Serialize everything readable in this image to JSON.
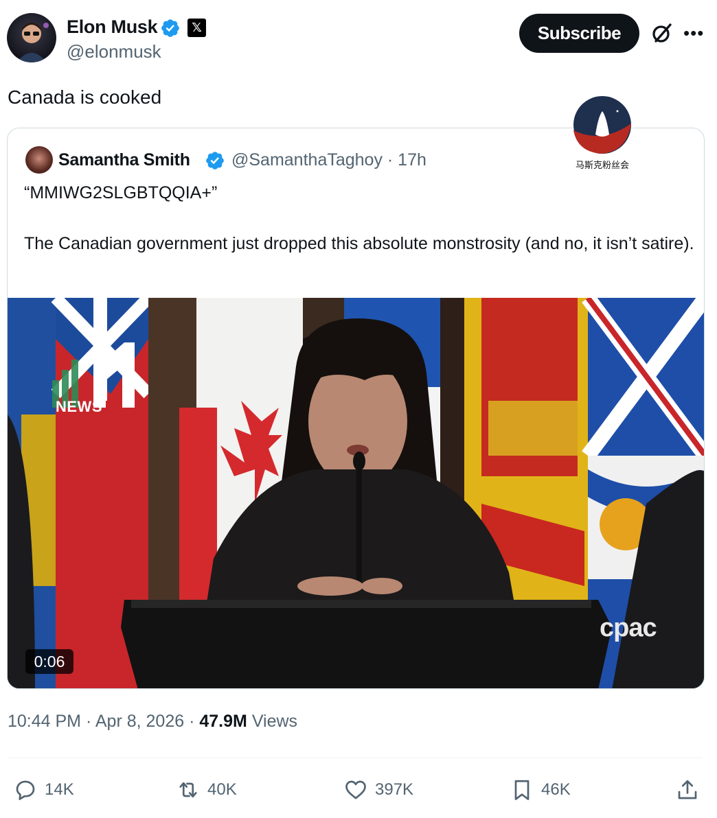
{
  "author": {
    "name": "Elon Musk",
    "handle": "@elonmusk",
    "badge_color": "#1d9bf0",
    "x_badge": "𝕏"
  },
  "header": {
    "subscribe_label": "Subscribe",
    "icons": [
      "grok-icon",
      "more-icon"
    ]
  },
  "tweet": {
    "text": "Canada is cooked",
    "time": "10:44 PM",
    "date": "Apr 8, 2026",
    "views_count": "47.9M",
    "views_label": "Views"
  },
  "watermark": {
    "label": "马斯克粉丝会"
  },
  "quote": {
    "name": "Samantha Smith",
    "handle_time": "@SamanthaTaghoy · 17h",
    "line1": "“MMIWG2SLGBTQQIA+”",
    "line2": "The Canadian government just dropped this absolute monstrosity (and no, it isn’t satire).",
    "video": {
      "duration": "0:06",
      "news_label": "NEWS",
      "broadcaster": "cpac"
    }
  },
  "actions": {
    "replies": "14K",
    "reposts": "40K",
    "likes": "397K",
    "bookmarks": "46K"
  },
  "colors": {
    "text_primary": "#0f1419",
    "text_secondary": "#536471",
    "verified_blue": "#1d9bf0",
    "border": "#cfd9de"
  }
}
